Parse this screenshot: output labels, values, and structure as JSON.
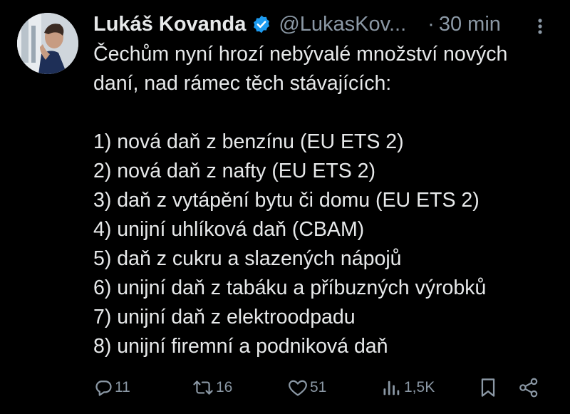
{
  "tweet": {
    "author_name": "Lukáš Kovanda",
    "handle": "@LukasKov...",
    "separator": "·",
    "time": "30 min",
    "text_lines": [
      "Čechům nyní hrozí nebývalé množství nových",
      "daní, nad rámec těch stávajících:",
      "",
      "1) nová daň z benzínu (EU ETS 2)",
      "2) nová daň z nafty (EU ETS 2)",
      "3) daň z vytápění bytu či domu (EU ETS 2)",
      "4) unijní uhlíková daň (CBAM)",
      "5) daň z cukru a slazených nápojů",
      "6) unijní daň z tabáku a příbuzných výrobků",
      "7) unijní daň z elektroodpadu",
      "8) unijní firemní a podniková daň"
    ],
    "actions": {
      "replies": "11",
      "reposts": "16",
      "likes": "51",
      "views": "1,5K"
    }
  },
  "icons": {
    "verified": "verified-badge-icon",
    "more": "more-options-icon",
    "reply": "reply-icon",
    "repost": "repost-icon",
    "like": "heart-icon",
    "views": "views-chart-icon",
    "bookmark": "bookmark-icon",
    "share": "share-icon"
  },
  "colors": {
    "background": "#000000",
    "text": "#e7e9ea",
    "secondary": "#8b98a5",
    "verified": "#1d9bf0"
  }
}
